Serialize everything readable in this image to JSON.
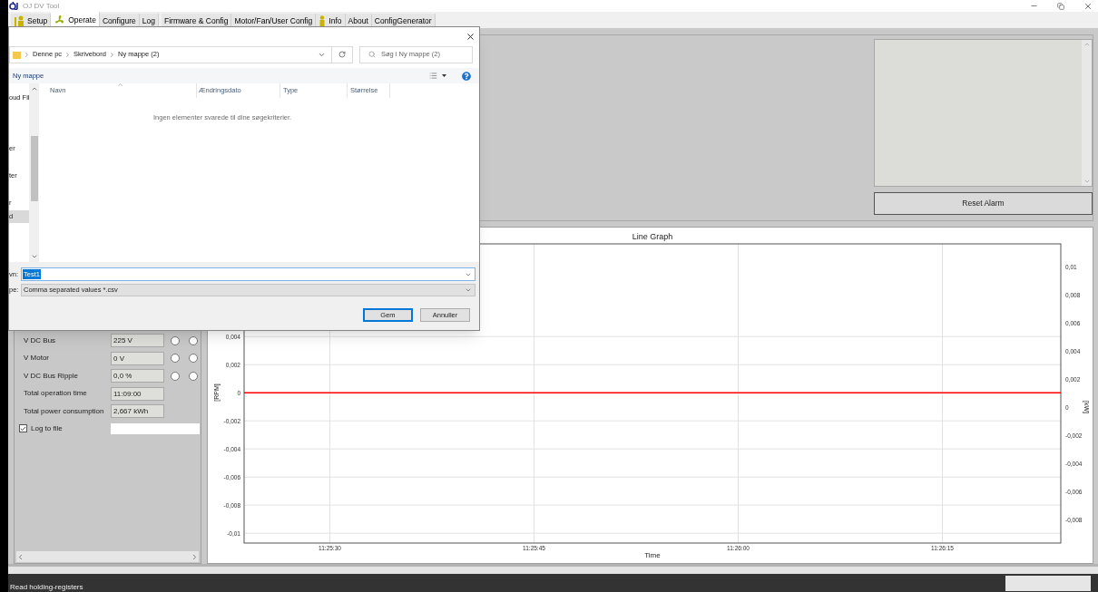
{
  "window": {
    "title": "OJ DV Tool"
  },
  "tabs": [
    {
      "label": "Setup",
      "selected": false,
      "kind": "iconic"
    },
    {
      "label": "Operate",
      "selected": true,
      "kind": "iconic"
    },
    {
      "label": "Configure",
      "selected": false,
      "kind": "plain"
    },
    {
      "label": "Log",
      "selected": false,
      "kind": "plain"
    },
    {
      "label": "Firmware & Config",
      "selected": false,
      "kind": "plain"
    },
    {
      "label": "Motor/Fan/User Config",
      "selected": false,
      "kind": "plain"
    },
    {
      "label": "Info",
      "selected": false,
      "kind": "iconic"
    },
    {
      "label": "About",
      "selected": false,
      "kind": "plain"
    },
    {
      "label": "ConfigGenerator",
      "selected": false,
      "kind": "plain"
    }
  ],
  "alarm_panel": {
    "button": "Reset Alarm"
  },
  "parameters": [
    {
      "label": "V DC Bus",
      "value": "225 V",
      "indicators": [
        {
          "on": false
        },
        {
          "on": false
        }
      ]
    },
    {
      "label": "V Motor",
      "value": "0 V",
      "indicators": [
        {
          "on": false
        },
        {
          "on": false
        }
      ]
    },
    {
      "label": "V DC Bus Ripple",
      "value": "0,0 %",
      "indicators": [
        {
          "on": false
        },
        {
          "on": false
        }
      ]
    },
    {
      "label": "Total operation time",
      "value": "11:09:00"
    },
    {
      "label": "Total power consumption",
      "value": "2,667 kWh"
    }
  ],
  "log_to_file": {
    "label": "Log to file",
    "checked": true
  },
  "graph": {
    "chart_data": {
      "type": "line",
      "title": "Line Graph",
      "xlabel": "Time",
      "ylabel": "[RPM]",
      "grid": true,
      "x": [
        41123.7,
        41183.7
      ],
      "series": [
        {
          "color": "#ff0000",
          "values": [
            0,
            0
          ]
        }
      ],
      "xlim": [
        41123.7,
        41183.7
      ],
      "ylim": [
        -0.0107,
        0.0106
      ],
      "xticks": [
        {
          "value": 41130,
          "label": "11:25:30"
        },
        {
          "value": 41145,
          "label": "11:25:45"
        },
        {
          "value": 41160,
          "label": "11:26:00"
        },
        {
          "value": 41175,
          "label": "11:26:15"
        }
      ],
      "yticks": [
        {
          "value": 0.004,
          "label": "0,004"
        },
        {
          "value": 0.002,
          "label": "0,002"
        },
        {
          "value": 0,
          "label": "0"
        },
        {
          "value": -0.002,
          "label": "-0,002"
        },
        {
          "value": -0.004,
          "label": "-0,004"
        },
        {
          "value": -0.006,
          "label": "-0,006"
        },
        {
          "value": -0.008,
          "label": "-0,008"
        },
        {
          "value": -0.01,
          "label": "-0,01"
        }
      ]
    },
    "right_axis": {
      "label": "[kW]",
      "tick_labels": [
        "0,01",
        "0,008",
        "0,006",
        "0,004",
        "0,002",
        "0",
        "-0,002",
        "-0,004",
        "-0,006",
        "-0,008"
      ]
    }
  },
  "save_dialog": {
    "breadcrumb": [
      "Denne pc",
      "Skrivebord",
      "Ny mappe (2)"
    ],
    "search": {
      "placeholder": "Søg i Ny mappe (2)"
    },
    "new_folder": "Ny mappe",
    "nav_items": [
      {
        "label": "oud Fil",
        "selected": false
      },
      {
        "label": "er",
        "selected": false
      },
      {
        "label": "ter",
        "selected": false
      },
      {
        "label": "r",
        "selected": false
      },
      {
        "label": "d",
        "selected": true
      }
    ],
    "columns": [
      "Navn",
      "Ændringsdato",
      "Type",
      "Størrelse"
    ],
    "empty_message": "Ingen elementer svarede til dine søgekriterier.",
    "filename": {
      "label": "vn:",
      "value": "Test1",
      "highlighted": true
    },
    "filetype": {
      "label": "pe:",
      "value": "Comma separated values *.csv"
    },
    "buttons": [
      {
        "label": "Gem",
        "default": true
      },
      {
        "label": "Annuller",
        "default": false
      }
    ]
  },
  "status_bar": {
    "message": "Read holding-registers"
  }
}
